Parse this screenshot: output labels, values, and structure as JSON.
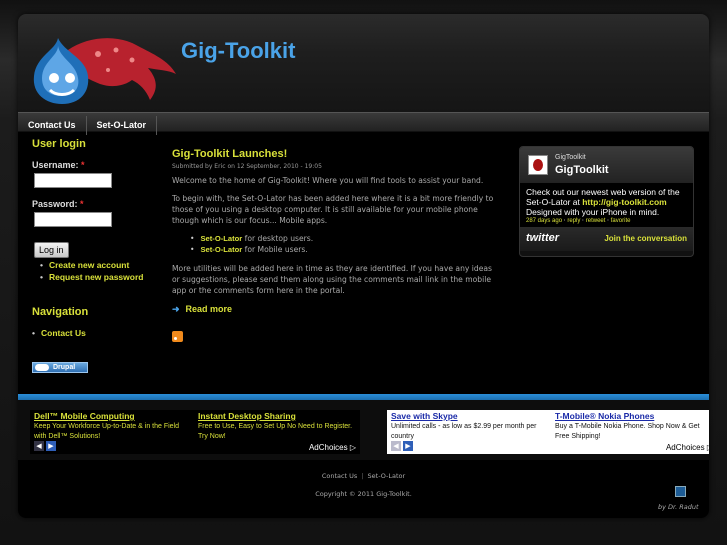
{
  "header": {
    "site_name": "Gig-Toolkit"
  },
  "nav": {
    "items": [
      {
        "label": "Contact Us"
      },
      {
        "label": "Set-O-Lator"
      }
    ]
  },
  "user_login": {
    "title": "User login",
    "username_label": "Username:",
    "password_label": "Password:",
    "required_mark": "*",
    "login_button": "Log in",
    "links": [
      "Create new account",
      "Request new password"
    ]
  },
  "navigation": {
    "title": "Navigation",
    "items": [
      "Contact Us"
    ]
  },
  "drupal_badge": "Drupal",
  "article": {
    "title": "Gig-Toolkit Launches!",
    "submitted": "Submitted by Eric on 12 September, 2010 - 19:05",
    "p1": "Welcome to the home of Gig-Toolkit! Where you will find tools to assist your band.",
    "p2": "To begin with, the Set-O-Lator has been added here where it is a bit more friendly to those of you using a desktop computer. It is still available for your mobile phone though which is our focus... Mobile apps.",
    "list": [
      {
        "bold": "Set-O-Lator",
        "rest": " for desktop users."
      },
      {
        "bold": "Set-O-Lator",
        "rest": " for Mobile users."
      }
    ],
    "p3": "More utilities will be added here in time as they are identified. If you have any ideas or suggestions, please send them along using the comments mail link in the mobile app or the comments form here in the portal.",
    "read_more": "Read more"
  },
  "twitter": {
    "handle": "GigToolkit",
    "name": "GigToolkit",
    "tweet_pre": "Check out our newest web version of the Set-O-Lator at ",
    "tweet_link": "http://gig-toolkit.com",
    "tweet_post": " Designed with your iPhone in mind.",
    "meta_age": "287 days ago",
    "meta_sep1": " · ",
    "meta_reply": "reply",
    "meta_sep2": " · ",
    "meta_retweet": "retweet",
    "meta_sep3": " · ",
    "meta_favorite": "favorite",
    "logo": "twitter",
    "join": "Join the conversation"
  },
  "ads_left": {
    "units": [
      {
        "title": "Dell™ Mobile Computing",
        "text": "Keep Your Workforce Up-to-Date & in the Field with Dell™ Solutions!"
      },
      {
        "title": "Instant Desktop Sharing",
        "text": "Free to Use, Easy to Set Up No Need to Register. Try Now!"
      }
    ],
    "choices": "AdChoices ▷"
  },
  "ads_right": {
    "units": [
      {
        "title": "Save with Skype",
        "text": "Unlimited calls - as low as $2.99 per month per country"
      },
      {
        "title": "T-Mobile® Nokia Phones",
        "text": "Buy a T-Mobile Nokia Phone. Shop Now & Get Free Shipping!"
      }
    ],
    "choices": "AdChoices ▷"
  },
  "footer": {
    "links": [
      "Contact Us",
      "Set-O-Lator"
    ],
    "separator": "|",
    "copyright": "Copyright © 2011 Gig-Toolkit.",
    "credit": "by Dr. Radut"
  }
}
